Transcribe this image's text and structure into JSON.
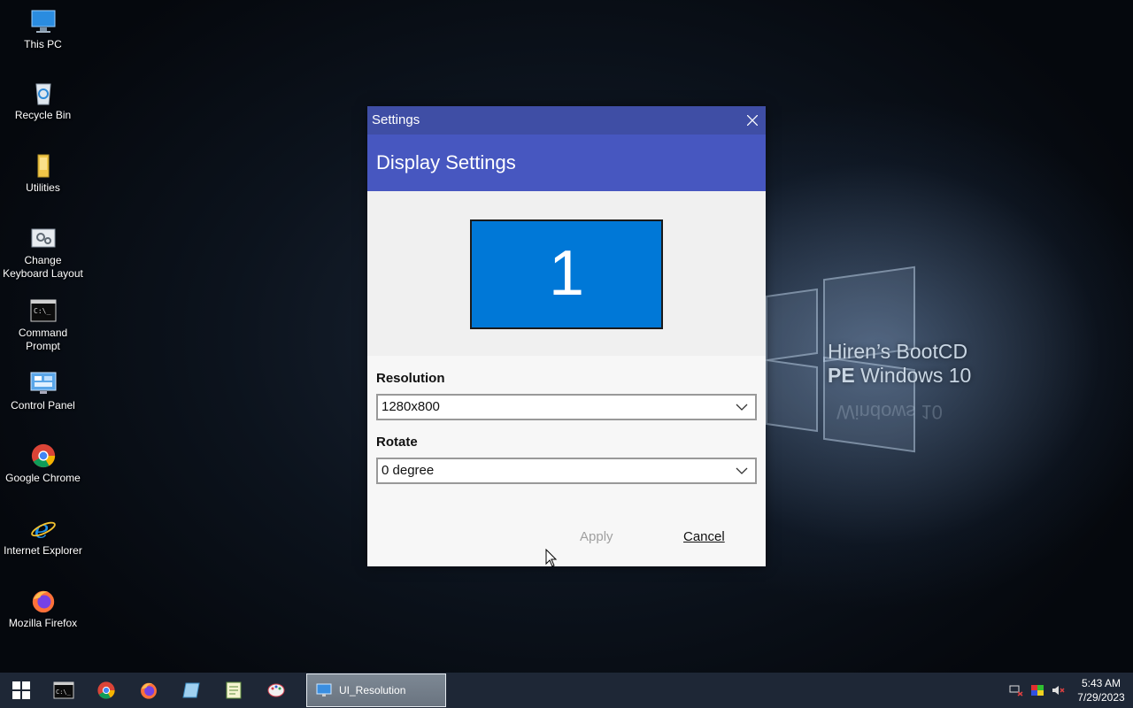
{
  "desktop": {
    "icons": [
      {
        "label": "This PC",
        "icon": "computer-icon"
      },
      {
        "label": "Recycle Bin",
        "icon": "recycle-bin-icon"
      },
      {
        "label": "Utilities",
        "icon": "folder-icon"
      },
      {
        "label": "Change Keyboard Layout",
        "icon": "keyboard-settings-icon"
      },
      {
        "label": "Command Prompt",
        "icon": "terminal-icon"
      },
      {
        "label": "Control Panel",
        "icon": "control-panel-icon"
      },
      {
        "label": "Google Chrome",
        "icon": "chrome-icon"
      },
      {
        "label": "Internet Explorer",
        "icon": "ie-icon"
      },
      {
        "label": "Mozilla Firefox",
        "icon": "firefox-icon"
      }
    ],
    "brand_line1": "Hiren’s BootCD",
    "brand_line2_bold": "PE",
    "brand_line2_rest": " Windows 10",
    "brand_reflection": "Windows 10"
  },
  "window": {
    "title": "Settings",
    "header": "Display Settings",
    "monitor_number": "1",
    "resolution_label": "Resolution",
    "resolution_value": "1280x800",
    "rotate_label": "Rotate",
    "rotate_value": "0 degree",
    "apply_label": "Apply",
    "cancel_label": "Cancel"
  },
  "taskbar": {
    "task_label": "UI_Resolution",
    "time": "5:43 AM",
    "date": "7/29/2023"
  },
  "colors": {
    "titlebar": "#3f4ea5",
    "header": "#4757c0",
    "monitor": "#0078d7",
    "taskbar": "#1e2736"
  }
}
